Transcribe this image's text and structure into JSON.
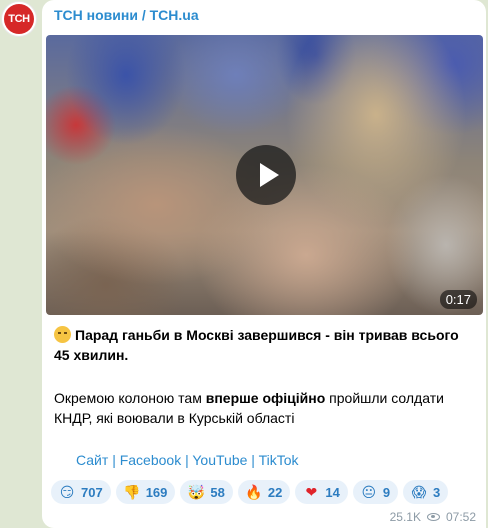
{
  "channel": {
    "name": "ТСН новини / TCH.ua",
    "avatar_text": "ТСН",
    "brand_color": "#d62828",
    "link_color": "#2c8ccf"
  },
  "media": {
    "duration": "0:17",
    "play_icon": "play-icon"
  },
  "post": {
    "emoji": "smirk-face-emoji",
    "headline": "Парад ганьби в Москві завершився - він тривав всього 45 хвилин.",
    "body_before": "Окремою колоною там ",
    "body_bold": "вперше офіційно",
    "body_after": " пройшли солдати КНДР, які воювали в Курській області"
  },
  "links": [
    {
      "label": "Сайт"
    },
    {
      "label": "Facebook"
    },
    {
      "label": "YouTube"
    },
    {
      "label": "TikTok"
    }
  ],
  "link_separator": "|",
  "reactions": [
    {
      "icon": "smirk-emoji",
      "glyph": "😏",
      "count": "707"
    },
    {
      "icon": "thumbs-down-emoji",
      "glyph": "👎",
      "count": "169"
    },
    {
      "icon": "exploding-head-emoji",
      "glyph": "🤯",
      "count": "58"
    },
    {
      "icon": "fire-emoji",
      "glyph": "🔥",
      "count": "22"
    },
    {
      "icon": "heart-emoji",
      "glyph": "❤",
      "count": "14"
    },
    {
      "icon": "neutral-face-emoji",
      "glyph": "😐",
      "count": "9"
    },
    {
      "icon": "screaming-face-emoji",
      "glyph": "😱",
      "count": "3"
    }
  ],
  "meta": {
    "views": "25.1K",
    "time": "07:52",
    "views_icon": "eye-icon"
  }
}
